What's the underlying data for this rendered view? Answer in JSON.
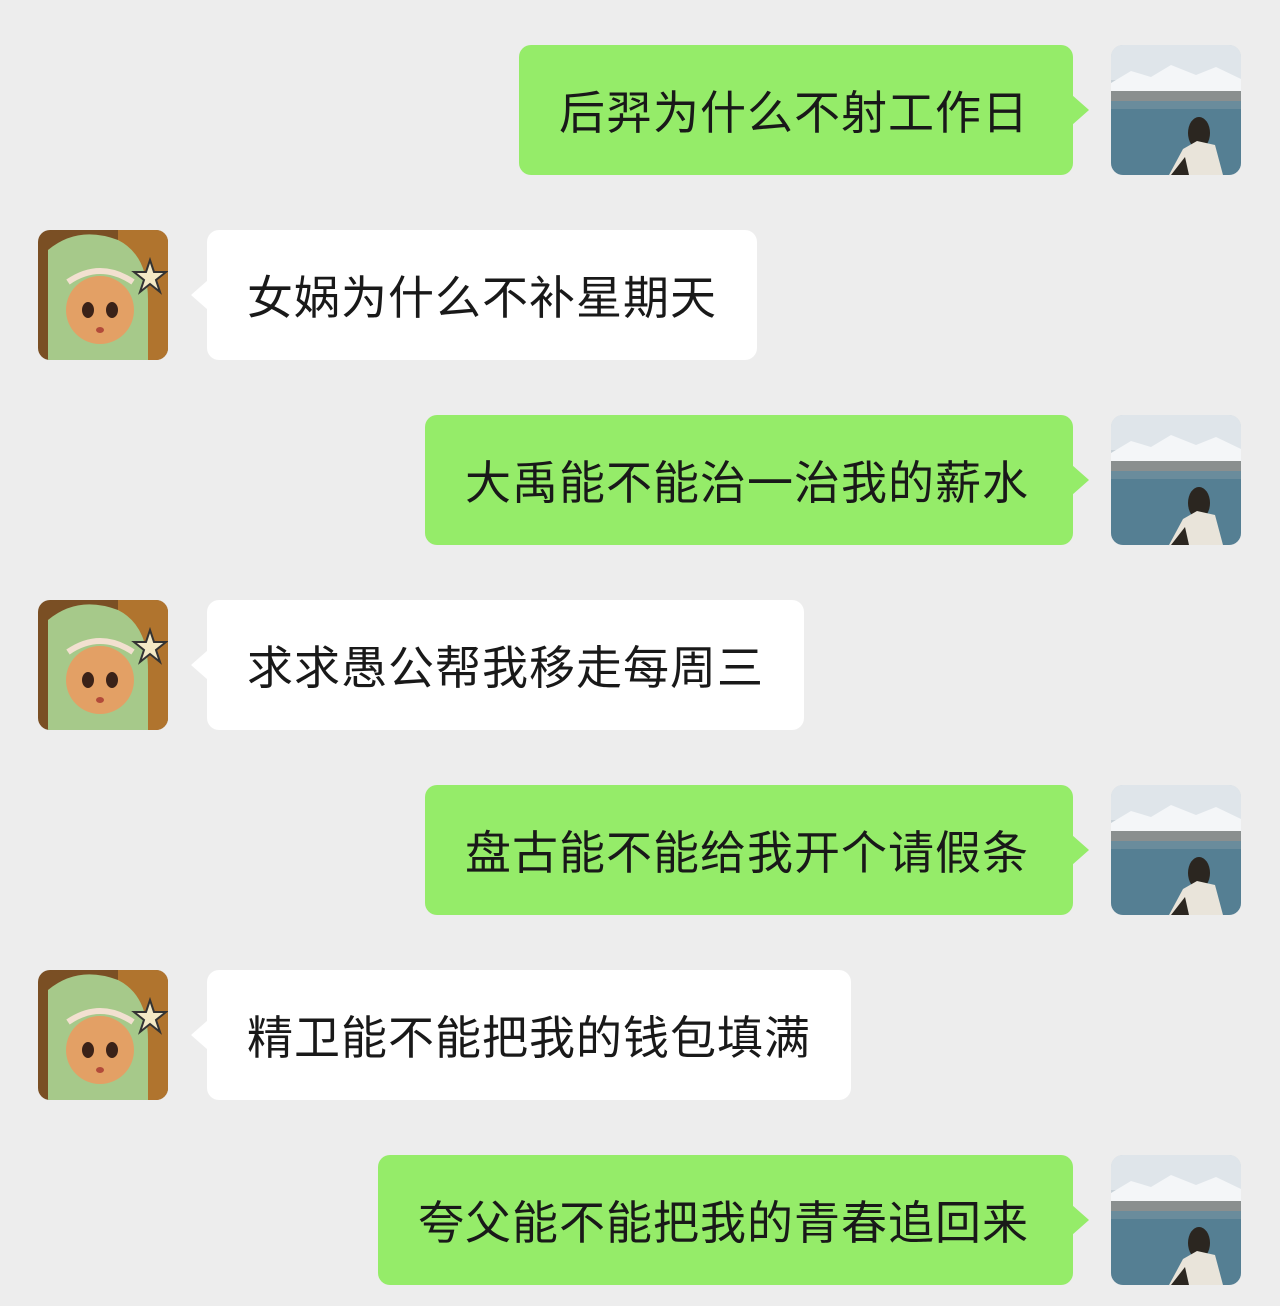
{
  "chat": {
    "messages": [
      {
        "sender": "me",
        "text": "后羿为什么不射工作日"
      },
      {
        "sender": "other",
        "text": "女娲为什么不补星期天"
      },
      {
        "sender": "me",
        "text": "大禹能不能治一治我的薪水"
      },
      {
        "sender": "other",
        "text": "求求愚公帮我移走每周三"
      },
      {
        "sender": "me",
        "text": "盘古能不能给我开个请假条"
      },
      {
        "sender": "other",
        "text": "精卫能不能把我的钱包填满"
      },
      {
        "sender": "me",
        "text": "夸父能不能把我的青春追回来"
      }
    ]
  },
  "colors": {
    "background": "#ededed",
    "my_bubble": "#95ec69",
    "other_bubble": "#ffffff",
    "text": "#191919"
  },
  "icons": {
    "my_avatar": "lake-mountain-avatar-icon",
    "other_avatar": "green-doll-avatar-icon"
  }
}
